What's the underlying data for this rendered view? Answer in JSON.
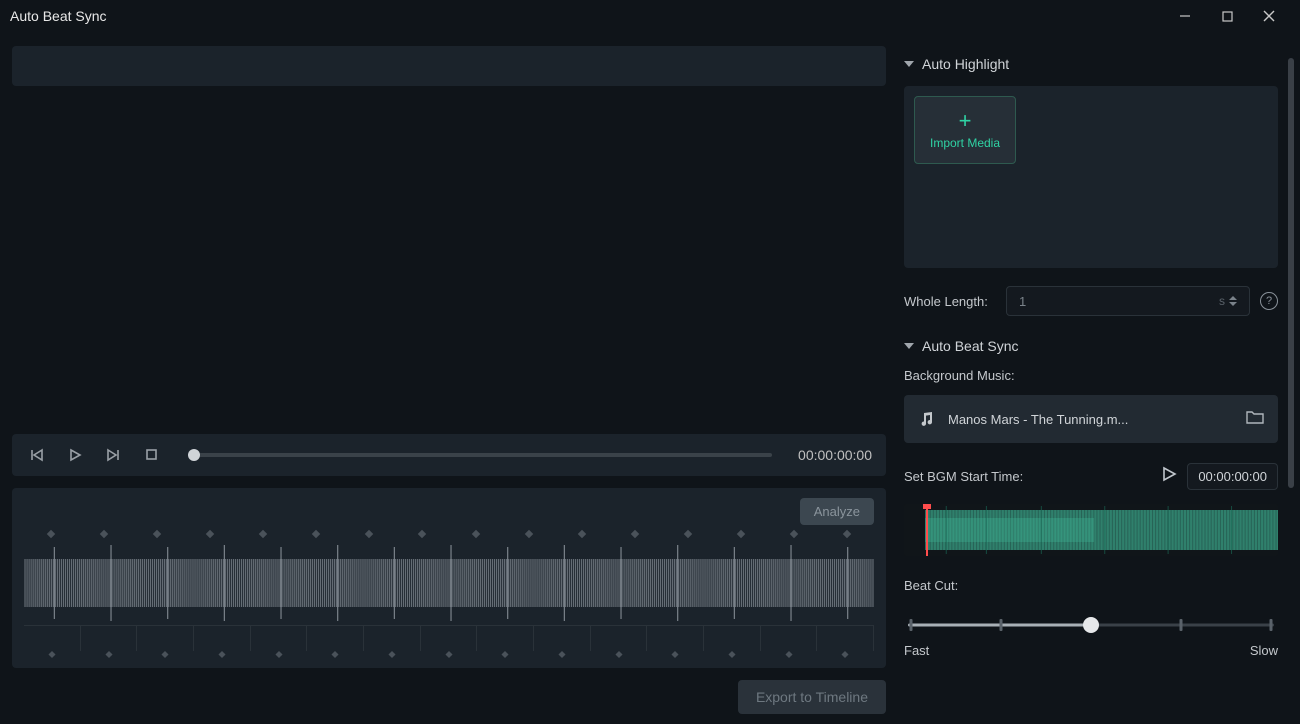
{
  "window": {
    "title": "Auto Beat Sync"
  },
  "player": {
    "timecode": "00:00:00:00"
  },
  "analyze_label": "Analyze",
  "export_label": "Export to Timeline",
  "sections": {
    "auto_highlight": {
      "title": "Auto Highlight",
      "import_label": "Import Media",
      "whole_length_label": "Whole Length:",
      "whole_length_value": "1",
      "whole_length_unit": "s"
    },
    "auto_beat_sync": {
      "title": "Auto Beat Sync",
      "bgm_label": "Background Music:",
      "bgm_file": "Manos Mars - The Tunning.m...",
      "start_time_label": "Set BGM Start Time:",
      "start_time_value": "00:00:00:00",
      "beat_cut_label": "Beat Cut:",
      "slider_left": "Fast",
      "slider_right": "Slow"
    }
  }
}
